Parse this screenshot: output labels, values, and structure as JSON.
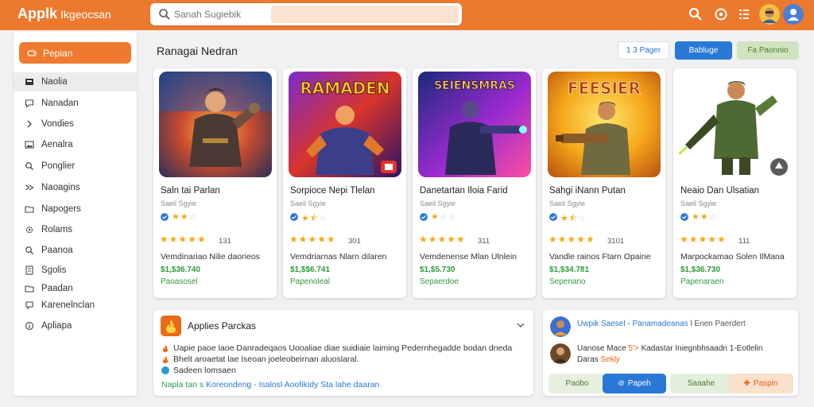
{
  "app": {
    "name": "Applk",
    "subtitle": "Ikgeocsan"
  },
  "search": {
    "placeholder": "Sanah Sugiebik"
  },
  "sidebar": {
    "primary": {
      "label": "Pepian",
      "icon": "gamepad-icon"
    },
    "items": [
      {
        "label": "Naolia",
        "icon": "monitor-icon"
      },
      {
        "label": "Nanadan",
        "icon": "chat-icon"
      },
      {
        "label": "Vondies",
        "icon": "chevron-icon"
      },
      {
        "label": "Aenalra",
        "icon": "image-icon"
      },
      {
        "label": "Ponglier",
        "icon": "search-icon"
      },
      {
        "label": "Naoagins",
        "icon": "tag-icon"
      },
      {
        "label": "Napogers",
        "icon": "folder-icon"
      },
      {
        "label": "Rolams",
        "icon": "gear-icon"
      },
      {
        "label": "Paanoa",
        "icon": "search-icon"
      },
      {
        "label": "Sgolis",
        "icon": "document-icon"
      },
      {
        "label": "Paadan",
        "icon": "folder-icon"
      },
      {
        "label": "Karenelnclan",
        "icon": "bookmark-icon"
      },
      {
        "label": "Apliapa",
        "icon": "info-icon"
      }
    ]
  },
  "main": {
    "title": "Ranagai Nedran",
    "header_buttons": [
      "1 3 Pager",
      "Babluge",
      "Fa Paonnio"
    ],
    "cards": [
      {
        "title": "Saln tai Parlan",
        "subtitle": "Saeil Sgyie",
        "rating_count": "131",
        "desc": "Vemdinariao Nilie daorieos",
        "price": "$1,$36.740",
        "status": "Paoasosel",
        "mini_rating": 2,
        "tint": "#2a6fd6"
      },
      {
        "title": "Sorpioce Nepi Tlelan",
        "subtitle": "Saeil Sgyie",
        "rating_count": "301",
        "desc": "Vemdriarnas Nlarn dilaren",
        "price": "$1,$$6.741",
        "status": "Papenoleal",
        "mini_rating": 1.5,
        "tint": "#2a6fd6",
        "banner": "RAMADEN"
      },
      {
        "title": "Danetartan Iloia Farid",
        "subtitle": "Saeil Sgyie",
        "rating_count": "311",
        "desc": "Vemdenense Mlan Ulnlein",
        "price": "$1,$5.730",
        "status": "Sepaerdoe",
        "mini_rating": 1,
        "tint": "#2a6fd6",
        "banner": "SEIENSMRAS"
      },
      {
        "title": "Sahgi iNann Putan",
        "subtitle": "Saeil Sgyie",
        "rating_count": "3101",
        "desc": "Vandle rainos Ftarn Opaine",
        "price": "$1,$34.781",
        "status": "Sepenano",
        "mini_rating": 1.5,
        "tint": "#2a6fd6",
        "banner": "FEESIER"
      },
      {
        "title": "Neaio Dan Ulsatian",
        "subtitle": "Saeil Sgyie",
        "rating_count": "111",
        "desc": "Marpockamao Solen IlMana",
        "price": "$1,$36.730",
        "status": "Papenaraen",
        "mini_rating": 2,
        "tint": "#2a6fd6"
      }
    ]
  },
  "panel_left": {
    "title": "Applies Parckas",
    "lines": [
      "Uapie paoe laoe Danradeqaos Uooaliae diae suidiaie laiming Pedernhegadde bodan dneda",
      "Bhelt aroaetat lae Iseoan joeleobeirnan aluoslaral.",
      "Sadeen lomsaen"
    ],
    "link_green": "Napla tan s",
    "link_blue": "Koreondeng - Isalosl Aoofikidy",
    "link_tail": "Sta lahe daaran"
  },
  "panel_right": {
    "review1_name": "Uwpik Saesel",
    "review1_sep": "-",
    "review1_role": "Panamadeanas",
    "review1_tail": "l Enen Paerdert",
    "review2_a": "Uanose Mace",
    "review2_b": "5'>",
    "review2_c": "Kadastar Iniegnbhsaadn 1-Eotlelin",
    "review2_d": "Daras",
    "review2_e": "Sekly",
    "buttons": [
      "Paobo",
      "Papeh",
      "Saaahe",
      "Paspin"
    ]
  },
  "colors": {
    "brand": "#ec7a2e",
    "accent_blue": "#2a78d6",
    "success": "#2d9a3a",
    "star": "#f3a81b"
  }
}
